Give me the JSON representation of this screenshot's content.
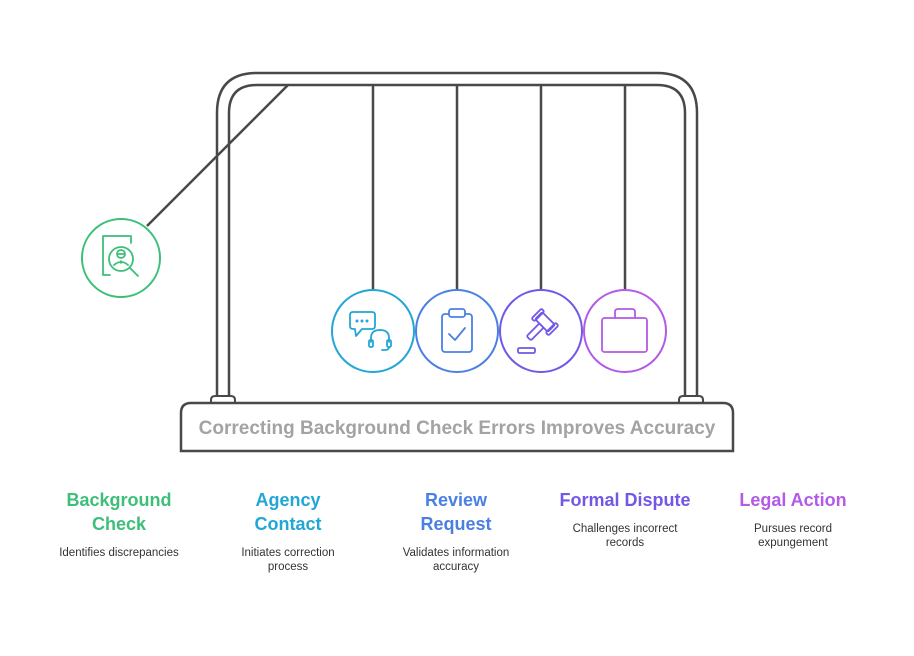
{
  "title": "Correcting Background Check Errors Improves Accuracy",
  "colors": {
    "frame": "#484848",
    "title_text": "#a3a3a3",
    "desc_text": "#333333"
  },
  "steps": [
    {
      "title": "Background Check",
      "title_lines": [
        "Background",
        "Check"
      ],
      "description": "Identifies discrepancies",
      "color": "#3dbf7a",
      "icon": "person-search-document-icon"
    },
    {
      "title": "Agency Contact",
      "title_lines": [
        "Agency",
        "Contact"
      ],
      "description": "Initiates correction process",
      "color": "#22a6d6",
      "icon": "chat-headset-icon"
    },
    {
      "title": "Review Request",
      "title_lines": [
        "Review",
        "Request"
      ],
      "description": "Validates information accuracy",
      "color": "#4a80e4",
      "icon": "clipboard-check-icon"
    },
    {
      "title": "Formal Dispute",
      "title_lines": [
        "Formal Dispute"
      ],
      "description": "Challenges incorrect records",
      "color": "#7357e6",
      "icon": "gavel-icon"
    },
    {
      "title": "Legal Action",
      "title_lines": [
        "Legal Action"
      ],
      "description": "Pursues record expungement",
      "color": "#b35ae6",
      "icon": "briefcase-icon"
    }
  ]
}
